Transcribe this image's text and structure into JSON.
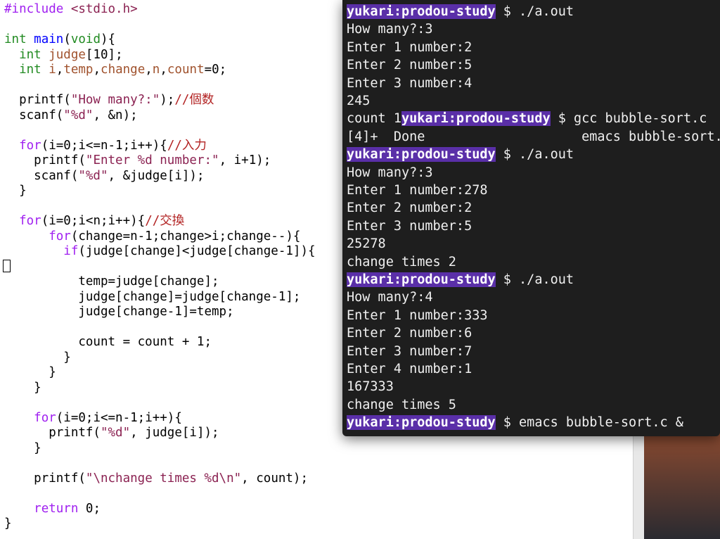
{
  "editor": {
    "lines": [
      [
        {
          "t": "#include ",
          "c": "k"
        },
        {
          "t": "<stdio.h>",
          "c": "s"
        }
      ],
      [],
      [
        {
          "t": "int",
          "c": "t"
        },
        {
          "t": " "
        },
        {
          "t": "main",
          "c": "f"
        },
        {
          "t": "("
        },
        {
          "t": "void",
          "c": "t"
        },
        {
          "t": "){"
        }
      ],
      [
        {
          "t": "  "
        },
        {
          "t": "int",
          "c": "t"
        },
        {
          "t": " "
        },
        {
          "t": "judge",
          "c": "v"
        },
        {
          "t": "[10];"
        }
      ],
      [
        {
          "t": "  "
        },
        {
          "t": "int",
          "c": "t"
        },
        {
          "t": " "
        },
        {
          "t": "i",
          "c": "v"
        },
        {
          "t": ","
        },
        {
          "t": "temp",
          "c": "v"
        },
        {
          "t": ","
        },
        {
          "t": "change",
          "c": "v"
        },
        {
          "t": ","
        },
        {
          "t": "n",
          "c": "v"
        },
        {
          "t": ","
        },
        {
          "t": "count",
          "c": "v"
        },
        {
          "t": "=0;"
        }
      ],
      [],
      [
        {
          "t": "  printf("
        },
        {
          "t": "\"How many?:\"",
          "c": "s"
        },
        {
          "t": ");"
        },
        {
          "t": "//個数",
          "c": "c"
        }
      ],
      [
        {
          "t": "  scanf("
        },
        {
          "t": "\"%d\"",
          "c": "s"
        },
        {
          "t": ", &n);"
        }
      ],
      [],
      [
        {
          "t": "  "
        },
        {
          "t": "for",
          "c": "k"
        },
        {
          "t": "(i=0;i<=n-1;i++){"
        },
        {
          "t": "//入力",
          "c": "c"
        }
      ],
      [
        {
          "t": "    printf("
        },
        {
          "t": "\"Enter %d number:\"",
          "c": "s"
        },
        {
          "t": ", i+1);"
        }
      ],
      [
        {
          "t": "    scanf("
        },
        {
          "t": "\"%d\"",
          "c": "s"
        },
        {
          "t": ", &judge[i]);"
        }
      ],
      [
        {
          "t": "  }"
        }
      ],
      [],
      [
        {
          "t": "  "
        },
        {
          "t": "for",
          "c": "k"
        },
        {
          "t": "(i=0;i<n;i++){"
        },
        {
          "t": "//交換",
          "c": "c"
        }
      ],
      [
        {
          "t": "      "
        },
        {
          "t": "for",
          "c": "k"
        },
        {
          "t": "(change=n-1;change>i;change--){"
        }
      ],
      [
        {
          "t": "        "
        },
        {
          "t": "if",
          "c": "k"
        },
        {
          "t": "(judge[change]<judge[change-1]){"
        }
      ],
      [],
      [
        {
          "t": "          temp=judge[change];"
        }
      ],
      [
        {
          "t": "          judge[change]=judge[change-1];"
        }
      ],
      [
        {
          "t": "          judge[change-1]=temp;"
        }
      ],
      [],
      [
        {
          "t": "          count = count + 1;"
        }
      ],
      [
        {
          "t": "        }"
        }
      ],
      [
        {
          "t": "      }"
        }
      ],
      [
        {
          "t": "    }"
        }
      ],
      [],
      [
        {
          "t": "    "
        },
        {
          "t": "for",
          "c": "k"
        },
        {
          "t": "(i=0;i<=n-1;i++){"
        }
      ],
      [
        {
          "t": "      printf("
        },
        {
          "t": "\"%d\"",
          "c": "s"
        },
        {
          "t": ", judge[i]);"
        }
      ],
      [
        {
          "t": "    }"
        }
      ],
      [],
      [
        {
          "t": "    printf("
        },
        {
          "t": "\"\\nchange times %d\\n\"",
          "c": "s"
        },
        {
          "t": ", count);"
        }
      ],
      [],
      [
        {
          "t": "    "
        },
        {
          "t": "return",
          "c": "k"
        },
        {
          "t": " 0;"
        }
      ],
      [
        {
          "t": "}"
        }
      ]
    ]
  },
  "terminal": {
    "prompt_user": "yukari:prodou-study",
    "lines": [
      {
        "prompt": true,
        "cmd": " $ ./a.out"
      },
      {
        "text": "How many?:3"
      },
      {
        "text": "Enter 1 number:2"
      },
      {
        "text": "Enter 2 number:5"
      },
      {
        "text": "Enter 3 number:4"
      },
      {
        "text": "245"
      },
      {
        "text": "count 1",
        "prompt_inline": true,
        "cmd": " $ gcc bubble-sort.c"
      },
      {
        "text": "[4]+  Done                    emacs bubble-sort."
      },
      {
        "prompt": true,
        "cmd": " $ ./a.out"
      },
      {
        "text": "How many?:3"
      },
      {
        "text": "Enter 1 number:278"
      },
      {
        "text": "Enter 2 number:2"
      },
      {
        "text": "Enter 3 number:5"
      },
      {
        "text": "25278"
      },
      {
        "text": "change times 2"
      },
      {
        "prompt": true,
        "cmd": " $ ./a.out"
      },
      {
        "text": "How many?:4"
      },
      {
        "text": "Enter 1 number:333"
      },
      {
        "text": "Enter 2 number:6"
      },
      {
        "text": "Enter 3 number:7"
      },
      {
        "text": "Enter 4 number:1"
      },
      {
        "text": "167333"
      },
      {
        "text": "change times 5"
      },
      {
        "prompt": true,
        "cmd": " $ emacs bubble-sort.c &"
      }
    ]
  }
}
